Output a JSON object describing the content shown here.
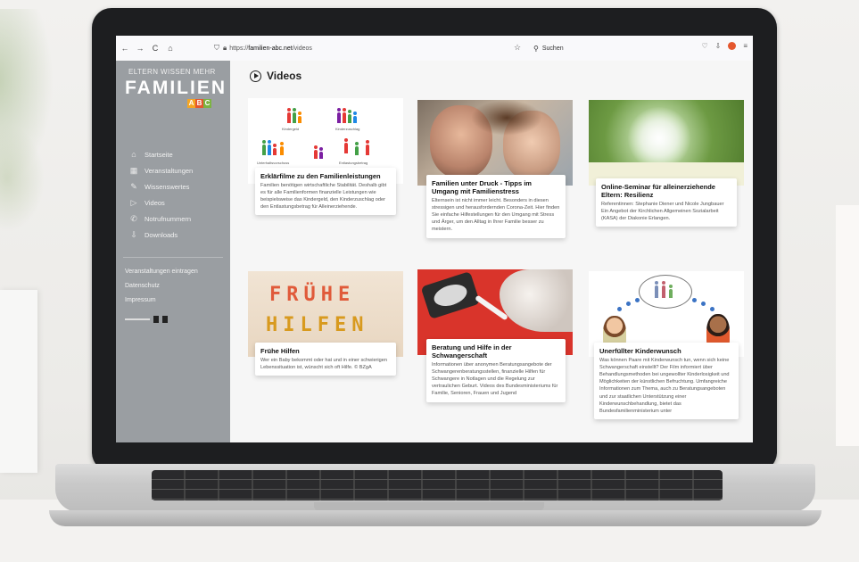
{
  "browser": {
    "url_host": "familien-abc.net",
    "url_prefix": "https://",
    "url_path": "/videos",
    "search_placeholder": "Suchen",
    "nav_back": "←",
    "nav_forward": "→",
    "nav_reload": "C",
    "nav_home": "⌂"
  },
  "sidebar": {
    "tagline": "ELTERN WISSEN MEHR",
    "logo": "FAMILIEN",
    "logo_abc": [
      "A",
      "B",
      "C"
    ],
    "logo_abc_colors": [
      "#f5a623",
      "#e4572e",
      "#7cb342"
    ],
    "menu": [
      {
        "label": "Startseite",
        "icon": "home-icon",
        "glyph": "⌂"
      },
      {
        "label": "Veranstaltungen",
        "icon": "calendar-icon",
        "glyph": "▦"
      },
      {
        "label": "Wissenswertes",
        "icon": "book-icon",
        "glyph": "✎"
      },
      {
        "label": "Videos",
        "icon": "play-icon",
        "glyph": "▷"
      },
      {
        "label": "Notrufnummern",
        "icon": "phone-icon",
        "glyph": "✆"
      },
      {
        "label": "Downloads",
        "icon": "download-icon",
        "glyph": "⇩"
      }
    ],
    "links": [
      "Veranstaltungen eintragen",
      "Datenschutz",
      "Impressum"
    ]
  },
  "main": {
    "title": "Videos",
    "cards": [
      {
        "title": "Erklärfilme zu den Familienleistungen",
        "text": "Familien benötigen wirtschaftliche Stabilität. Deshalb gibt es für alle Familienformen finanzielle Leistungen wie beispielsweise das Kindergeld, den Kinderzuschlag oder den Entlastungsbetrag für Alleinerziehende.",
        "thumb_labels": [
          "Kindergeld",
          "Kinderzuschlag",
          "Unterhaltsvorschuss",
          "Entlastungsbetrag"
        ]
      },
      {
        "title": "Familien unter Druck - Tipps im Umgang mit Familienstress",
        "text": "Elternsein ist nicht immer leicht. Besonders in diesen stressigen und herausfordernden Corona-Zeit. Hier finden Sie einfache Hilfestellungen für den Umgang mit Stress und Ärger, um den Alltag in Ihrer Familie besser zu meistern."
      },
      {
        "title": "Online-Seminar für alleinerziehende Eltern: Resilienz",
        "text": "Referentinnen: Stephanie Diener und Nicole Jungbauer Ein Angebot der Kirchlichen Allgemeinen Sozialarbeit (KASA) der Diakonie Erlangen."
      },
      {
        "title": "Frühe Hilfen",
        "text": "Wer ein Baby bekommt oder hat und in einer schwierigen Lebenssituation ist, wünscht sich oft Hilfe. © BZgA",
        "thumb_line1": "FRÜHE",
        "thumb_line2": "HILFEN"
      },
      {
        "title": "Beratung und Hilfe in der Schwangerschaft",
        "text": "Informationen über anonymen Beratungsangebote der Schwangerenberatungsstellen, finanzielle Hilfen für Schwangere in Notlagen und die Regelung zur vertraulichen Geburt. Videos des Bundesministeriums für Familie, Senioren, Frauen und Jugend"
      },
      {
        "title": "Unerfüllter Kinderwunsch",
        "text": "Was können Paare mit Kinderwunsch tun, wenn sich keine Schwangerschaft einstellt? Der Film informiert über Behandlungsmethoden bei ungewollter Kinderlosigkeit und Möglichkeiten der künstlichen Befruchtung. Umfangreiche Informationen zum Thema, auch zu Beratungsangeboten und zur staatlichen Unterstützung einer Kinderwunschbehandlung, bietet das Bundesfamilienministerium unter"
      }
    ]
  }
}
